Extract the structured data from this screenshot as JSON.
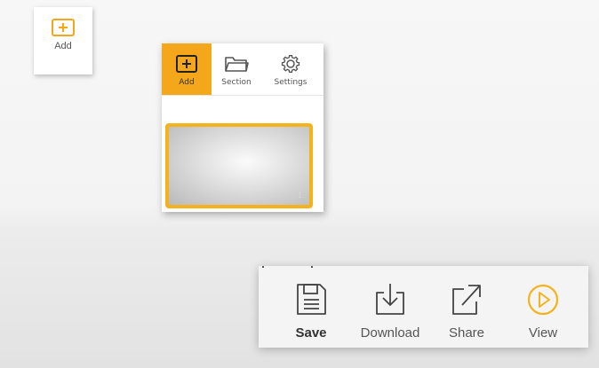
{
  "add_card": {
    "label": "Add",
    "icon": "plus-box-icon"
  },
  "panel": {
    "tools": [
      {
        "label": "Add",
        "icon": "plus-box-icon",
        "active": true
      },
      {
        "label": "Section",
        "icon": "folder-icon",
        "active": false
      },
      {
        "label": "Settings",
        "icon": "gear-icon",
        "active": false
      }
    ],
    "slide": {
      "number": "1",
      "selected": true
    }
  },
  "action_bar": {
    "actions": [
      {
        "label": "Save",
        "icon": "save-icon"
      },
      {
        "label": "Download",
        "icon": "download-icon"
      },
      {
        "label": "Share",
        "icon": "share-icon"
      },
      {
        "label": "View",
        "icon": "play-circle-icon"
      }
    ]
  },
  "colors": {
    "accent": "#f5a71b",
    "icon_stroke": "#444444",
    "label_text": "#555555"
  }
}
